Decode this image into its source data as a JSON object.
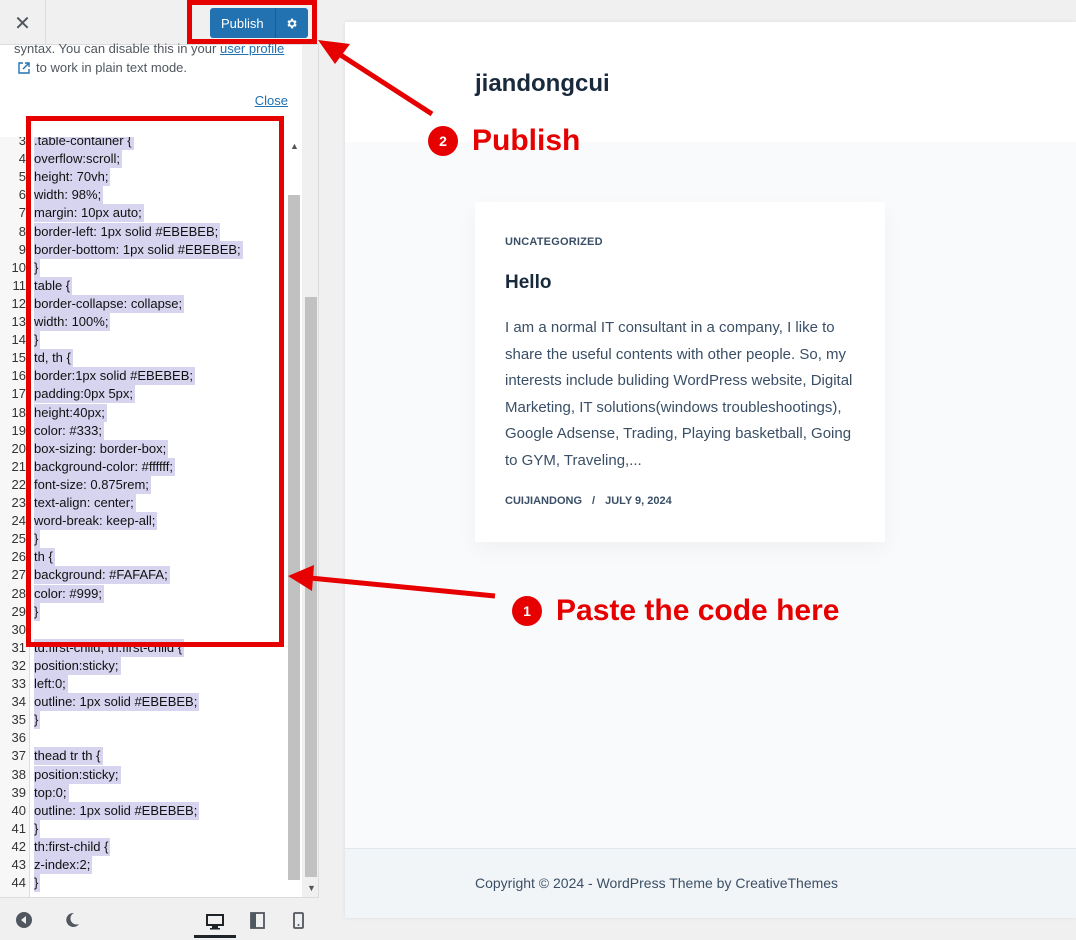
{
  "topbar": {
    "close_icon": "close-icon",
    "publish_label": "Publish",
    "gear_icon": "gear-icon"
  },
  "notice": {
    "line1_text": "syntax. You can disable this in your ",
    "line1_link": "user profile",
    "line2_text": "to work in plain text mode.",
    "external_icon": "external-link-icon",
    "close_label": "Close"
  },
  "code": [
    {
      "n": "3",
      "t": ".table-container {"
    },
    {
      "n": "4",
      "t": "overflow:scroll;"
    },
    {
      "n": "5",
      "t": "height: 70vh;"
    },
    {
      "n": "6",
      "t": "width: 98%;"
    },
    {
      "n": "7",
      "t": "margin: 10px auto;"
    },
    {
      "n": "8",
      "t": "border-left: 1px solid #EBEBEB;"
    },
    {
      "n": "9",
      "t": "border-bottom: 1px solid #EBEBEB;"
    },
    {
      "n": "10",
      "t": "}"
    },
    {
      "n": "11",
      "t": "table {"
    },
    {
      "n": "12",
      "t": "border-collapse: collapse;"
    },
    {
      "n": "13",
      "t": "width: 100%;"
    },
    {
      "n": "14",
      "t": "}"
    },
    {
      "n": "15",
      "t": "td, th {"
    },
    {
      "n": "16",
      "t": "border:1px solid #EBEBEB;"
    },
    {
      "n": "17",
      "t": "padding:0px 5px;"
    },
    {
      "n": "18",
      "t": "height:40px;"
    },
    {
      "n": "19",
      "t": "color: #333;"
    },
    {
      "n": "20",
      "t": "box-sizing: border-box;"
    },
    {
      "n": "21",
      "t": "background-color: #ffffff;"
    },
    {
      "n": "22",
      "t": "font-size: 0.875rem;"
    },
    {
      "n": "23",
      "t": "text-align: center;"
    },
    {
      "n": "24",
      "t": "word-break: keep-all;"
    },
    {
      "n": "25",
      "t": "}"
    },
    {
      "n": "26",
      "t": "th {"
    },
    {
      "n": "27",
      "t": "background: #FAFAFA;"
    },
    {
      "n": "28",
      "t": "color: #999;"
    },
    {
      "n": "29",
      "t": "}"
    },
    {
      "n": "30",
      "t": ""
    },
    {
      "n": "31",
      "t": "td:first-child, th:first-child {"
    },
    {
      "n": "32",
      "t": "position:sticky;"
    },
    {
      "n": "33",
      "t": "left:0;"
    },
    {
      "n": "34",
      "t": "outline: 1px solid #EBEBEB;"
    },
    {
      "n": "35",
      "t": "}"
    },
    {
      "n": "36",
      "t": ""
    },
    {
      "n": "37",
      "t": "thead tr th {"
    },
    {
      "n": "38",
      "t": "position:sticky;"
    },
    {
      "n": "39",
      "t": "top:0;"
    },
    {
      "n": "40",
      "t": "outline: 1px solid #EBEBEB;"
    },
    {
      "n": "41",
      "t": "}"
    },
    {
      "n": "42",
      "t": "th:first-child {"
    },
    {
      "n": "43",
      "t": "z-index:2;"
    },
    {
      "n": "44",
      "t": "}"
    }
  ],
  "bottombar": {
    "hide_icon": "collapse-arrow-icon",
    "dark_icon": "moon-icon",
    "desktop_icon": "desktop-icon",
    "tablet_icon": "tablet-icon",
    "mobile_icon": "mobile-icon"
  },
  "preview": {
    "site_title": "jiandongcui",
    "post": {
      "category": "UNCATEGORIZED",
      "title": "Hello",
      "excerpt": "I am a normal IT consultant in a company, I like to share the useful contents with other people. So, my interests include buliding WordPress website, Digital Marketing, IT solutions(windows troubleshootings), Google Adsense, Trading, Playing basketball, Going to GYM, Traveling,...",
      "author": "CUIJIANDONG",
      "separator": "/",
      "date": "JULY 9, 2024"
    },
    "footer": "Copyright © 2024 - WordPress Theme by CreativeThemes"
  },
  "annotations": {
    "step1_num": "1",
    "step1_label": "Paste the code here",
    "step2_num": "2",
    "step2_label": "Publish",
    "color": "#e60000"
  }
}
